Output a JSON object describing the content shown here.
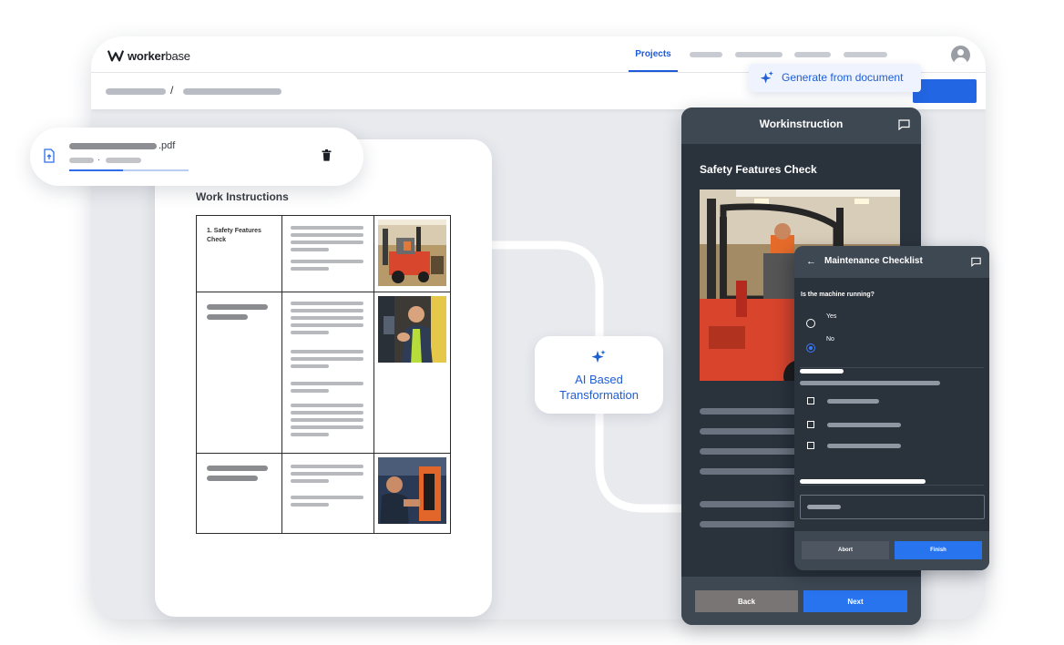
{
  "app": {
    "brand_bold": "worker",
    "brand_light": "base"
  },
  "nav": {
    "projects_label": "Projects"
  },
  "breadcrumb": {
    "separator": "/"
  },
  "generate_button": {
    "label": "Generate from document"
  },
  "upload": {
    "file_extension": ".pdf",
    "meta_separator": "·",
    "progress": 0.45
  },
  "document": {
    "title": "Work Instructions",
    "step1_label": "1. Safety Features Check"
  },
  "transformation": {
    "label_line1": "AI Based",
    "label_line2": "Transformation"
  },
  "workinstruction": {
    "title": "Workinstruction",
    "section_title": "Safety Features Check",
    "back_label": "Back",
    "next_label": "Next"
  },
  "checklist": {
    "back_arrow": "←",
    "title": "Maintenance Checklist",
    "question": "Is the machine running?",
    "options": [
      "Yes",
      "No"
    ],
    "selected_option": "No",
    "abort_label": "Abort",
    "finish_label": "Finish"
  },
  "colors": {
    "accent": "#2266e3",
    "dark_panel": "#2a323c",
    "canvas": "#e8eaee"
  }
}
